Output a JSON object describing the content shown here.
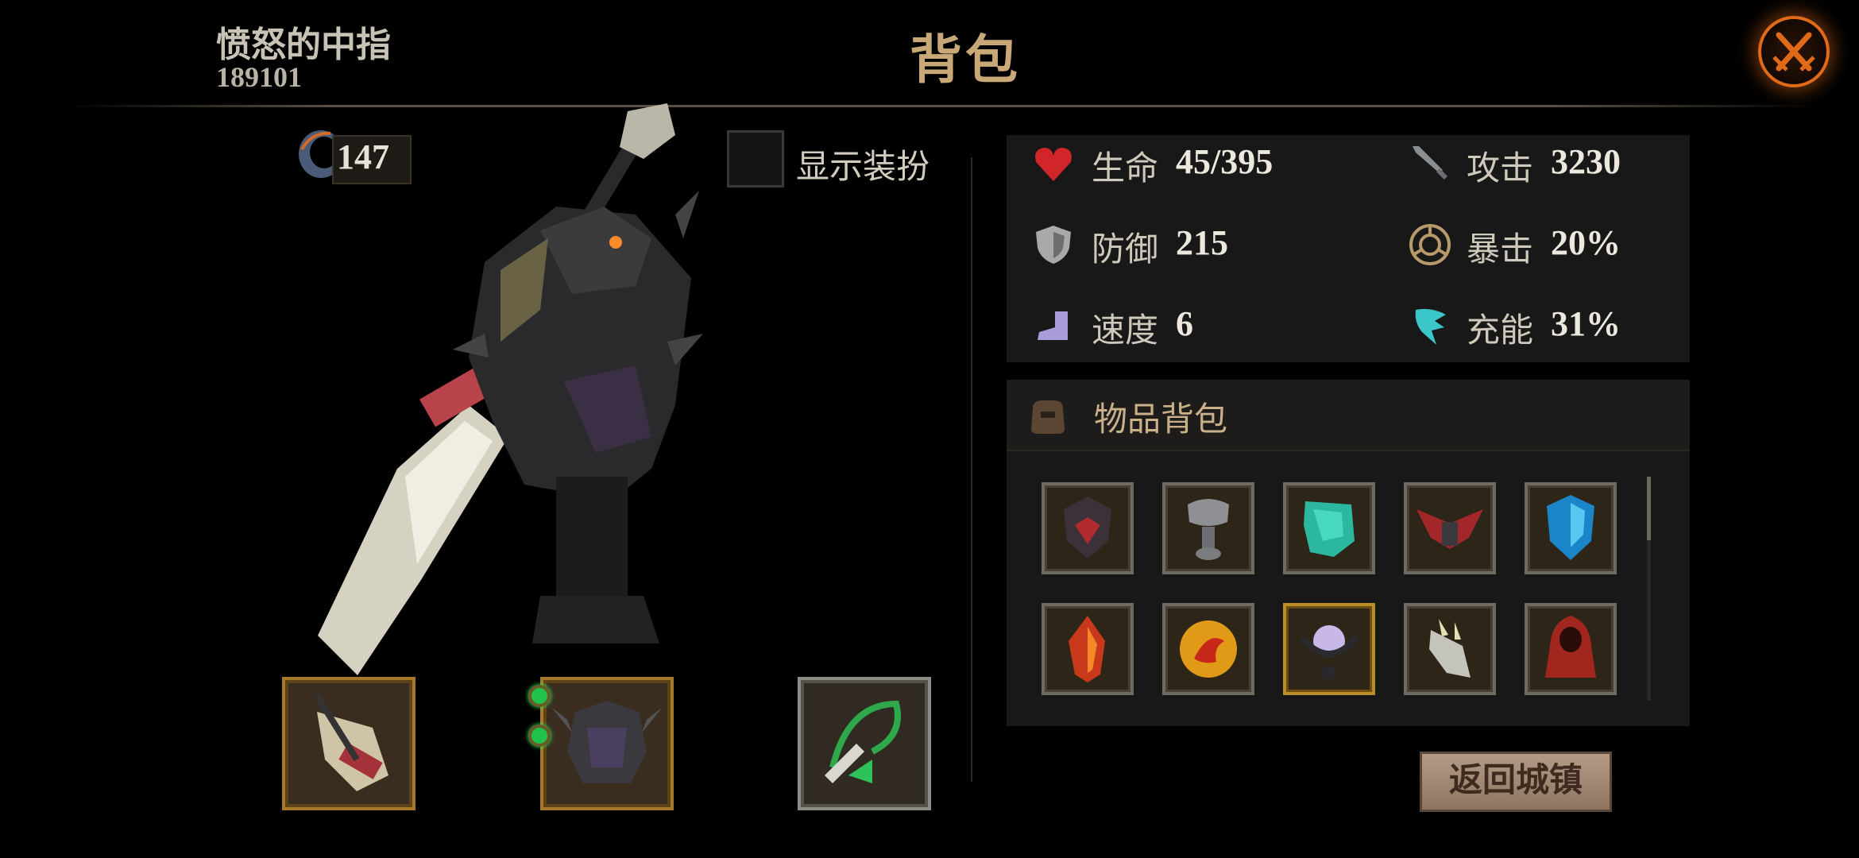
{
  "header": {
    "player_name": "愤怒的中指",
    "player_id": "189101",
    "title": "背包"
  },
  "left": {
    "soul_count": "147",
    "costume_toggle_label": "显示装扮",
    "costume_toggle_checked": false
  },
  "stats": [
    {
      "label": "生命",
      "value": "45/395",
      "icon": "heart-icon",
      "color": "#d0262a"
    },
    {
      "label": "攻击",
      "value": "3230",
      "icon": "sword-icon",
      "color": "#8a8e92"
    },
    {
      "label": "防御",
      "value": "215",
      "icon": "shield-icon",
      "color": "#a9a9a9"
    },
    {
      "label": "暴击",
      "value": "20%",
      "icon": "crit-icon",
      "color": "#b89a6a"
    },
    {
      "label": "速度",
      "value": "6",
      "icon": "boot-icon",
      "color": "#a99cd8"
    },
    {
      "label": "充能",
      "value": "31%",
      "icon": "energy-icon",
      "color": "#3bc7c9"
    }
  ],
  "inventory": {
    "title": "物品背包",
    "items": [
      {
        "name": "dark-helmet-icon"
      },
      {
        "name": "steel-pauldron-icon"
      },
      {
        "name": "jade-shield-icon"
      },
      {
        "name": "red-wings-icon"
      },
      {
        "name": "ice-crystal-shield-icon"
      },
      {
        "name": "fire-crystal-icon"
      },
      {
        "name": "fire-orb-icon"
      },
      {
        "name": "spiked-orb-amulet-icon"
      },
      {
        "name": "spiked-gauntlet-icon"
      },
      {
        "name": "red-hood-cloak-icon"
      }
    ]
  },
  "equipment": [
    {
      "name": "equipped-weapon-icon"
    },
    {
      "name": "equipped-armor-icon",
      "gems": 2
    },
    {
      "name": "equipped-necklace-icon"
    }
  ],
  "return_button_label": "返回城镇",
  "colors": {
    "title_gold": "#c9a877",
    "close_orange": "#e06a18",
    "panel_bg": "#181818"
  }
}
